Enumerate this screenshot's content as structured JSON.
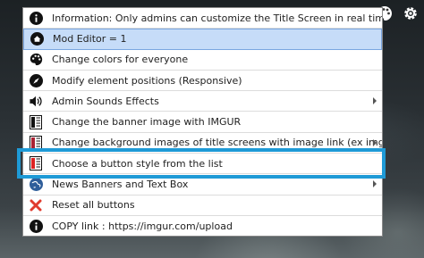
{
  "menu": {
    "items": [
      {
        "icon": "info-icon",
        "label": "Information: Only admins can customize the Title Screen in real time"
      },
      {
        "icon": "home-icon",
        "label": "Mod Editor = 1"
      },
      {
        "icon": "palette-icon",
        "label": "Change colors for everyone"
      },
      {
        "icon": "compass-icon",
        "label": "Modify element positions (Responsive)"
      },
      {
        "icon": "speaker-icon",
        "label": "Admin Sounds Effects"
      },
      {
        "icon": "image-frame-icon",
        "label": "Change the banner image with IMGUR"
      },
      {
        "icon": "image-frame-icon",
        "label": "Change background images of title screens with image link (ex imgur)"
      },
      {
        "icon": "button-style-icon",
        "label": "Choose a button style from the list"
      },
      {
        "icon": "globe-icon",
        "label": "News Banners and Text Box"
      },
      {
        "icon": "close-icon",
        "label": "Reset all buttons"
      },
      {
        "icon": "info-icon",
        "label": "COPY link : https://imgur.com/upload"
      }
    ]
  },
  "colors": {
    "highlight": "#1e9ad6",
    "active_row": "#c6dcf8",
    "reset_red": "#e03b2e"
  }
}
